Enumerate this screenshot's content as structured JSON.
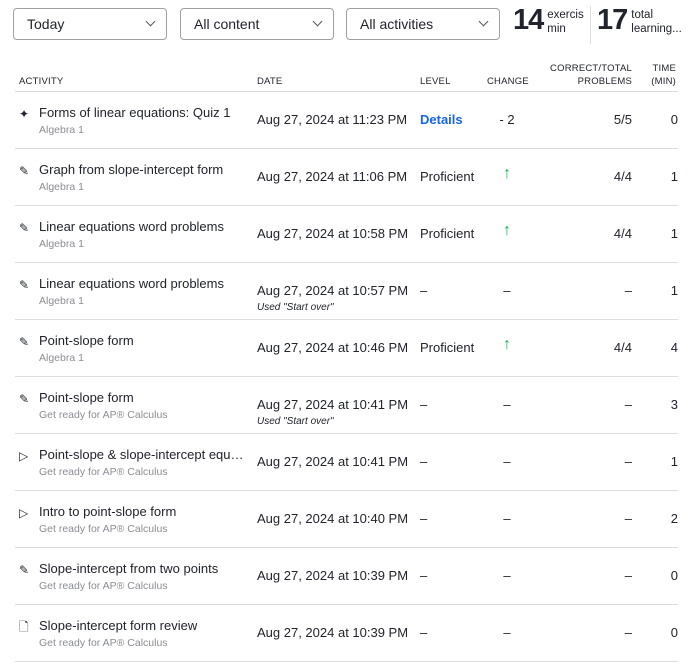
{
  "filters": [
    {
      "value": "Today"
    },
    {
      "value": "All content"
    },
    {
      "value": "All activities"
    }
  ],
  "stats": [
    {
      "value": "14",
      "label1": "exercis",
      "label2": "min"
    },
    {
      "value": "17",
      "label1": "total",
      "label2": "learning..."
    }
  ],
  "columns": {
    "activity": "ACTIVITY",
    "date": "DATE",
    "level": "LEVEL",
    "change": "CHANGE",
    "correct1": "CORRECT/TOTAL",
    "correct2": "PROBLEMS",
    "time1": "TIME",
    "time2": "(MIN)"
  },
  "colors": {
    "link": "#1865f2",
    "up": "#1fab54"
  },
  "rows": [
    {
      "icon": "quiz-sparkle-icon",
      "title": "Forms of linear equations: Quiz 1",
      "course": "Algebra 1",
      "date": "Aug 27, 2024 at 11:23 PM",
      "note": "",
      "level": "Details",
      "change": "- 2",
      "correct": "5/5",
      "time": "0"
    },
    {
      "icon": "pencil-icon",
      "title": "Graph from slope-intercept form",
      "course": "Algebra 1",
      "date": "Aug 27, 2024 at 11:06 PM",
      "note": "",
      "level": "Proficient",
      "change": "↑",
      "correct": "4/4",
      "time": "1"
    },
    {
      "icon": "pencil-icon",
      "title": "Linear equations word problems",
      "course": "Algebra 1",
      "date": "Aug 27, 2024 at 10:58 PM",
      "note": "",
      "level": "Proficient",
      "change": "↑",
      "correct": "4/4",
      "time": "1"
    },
    {
      "icon": "pencil-icon",
      "title": "Linear equations word problems",
      "course": "Algebra 1",
      "date": "Aug 27, 2024 at 10:57 PM",
      "note": "Used \"Start over\"",
      "level": "–",
      "change": "–",
      "correct": "–",
      "time": "1"
    },
    {
      "icon": "pencil-icon",
      "title": "Point-slope form",
      "course": "Algebra 1",
      "date": "Aug 27, 2024 at 10:46 PM",
      "note": "",
      "level": "Proficient",
      "change": "↑",
      "correct": "4/4",
      "time": "4"
    },
    {
      "icon": "pencil-icon",
      "title": "Point-slope form",
      "course": "Get ready for AP® Calculus",
      "date": "Aug 27, 2024 at 10:41 PM",
      "note": "Used \"Start over\"",
      "level": "–",
      "change": "–",
      "correct": "–",
      "time": "3"
    },
    {
      "icon": "play-icon",
      "title": "Point-slope & slope-intercept equations",
      "course": "Get ready for AP® Calculus",
      "date": "Aug 27, 2024 at 10:41 PM",
      "note": "",
      "level": "–",
      "change": "–",
      "correct": "–",
      "time": "1"
    },
    {
      "icon": "play-icon",
      "title": "Intro to point-slope form",
      "course": "Get ready for AP® Calculus",
      "date": "Aug 27, 2024 at 10:40 PM",
      "note": "",
      "level": "–",
      "change": "–",
      "correct": "–",
      "time": "2"
    },
    {
      "icon": "pencil-icon",
      "title": "Slope-intercept from two points",
      "course": "Get ready for AP® Calculus",
      "date": "Aug 27, 2024 at 10:39 PM",
      "note": "",
      "level": "–",
      "change": "–",
      "correct": "–",
      "time": "0"
    },
    {
      "icon": "article-icon",
      "title": "Slope-intercept form review",
      "course": "Get ready for AP® Calculus",
      "date": "Aug 27, 2024 at 10:39 PM",
      "note": "",
      "level": "–",
      "change": "–",
      "correct": "–",
      "time": "0"
    }
  ]
}
